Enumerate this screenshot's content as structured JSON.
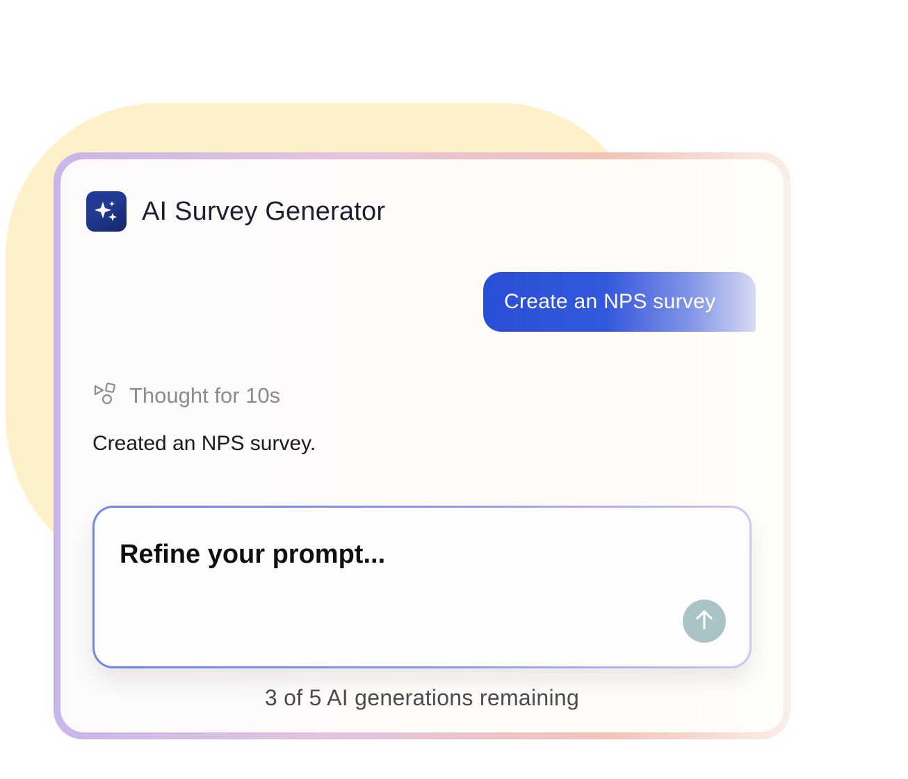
{
  "header": {
    "title": "AI Survey Generator",
    "icon": "sparkles-icon"
  },
  "chat": {
    "user_message": "Create an NPS survey",
    "thought_label": "Thought for 10s",
    "thought_icon": "shapes-icon",
    "assistant_reply": "Created an NPS survey."
  },
  "prompt": {
    "placeholder": "Refine your prompt...",
    "send_icon": "arrow-up-icon"
  },
  "footer": {
    "remaining": "3 of 5 AI generations remaining"
  },
  "colors": {
    "accent": "#2a4fd6",
    "app_icon_bg": "#1f3b97",
    "background_blob": "#fcf1c8",
    "send_button": "#a9c3c6"
  }
}
